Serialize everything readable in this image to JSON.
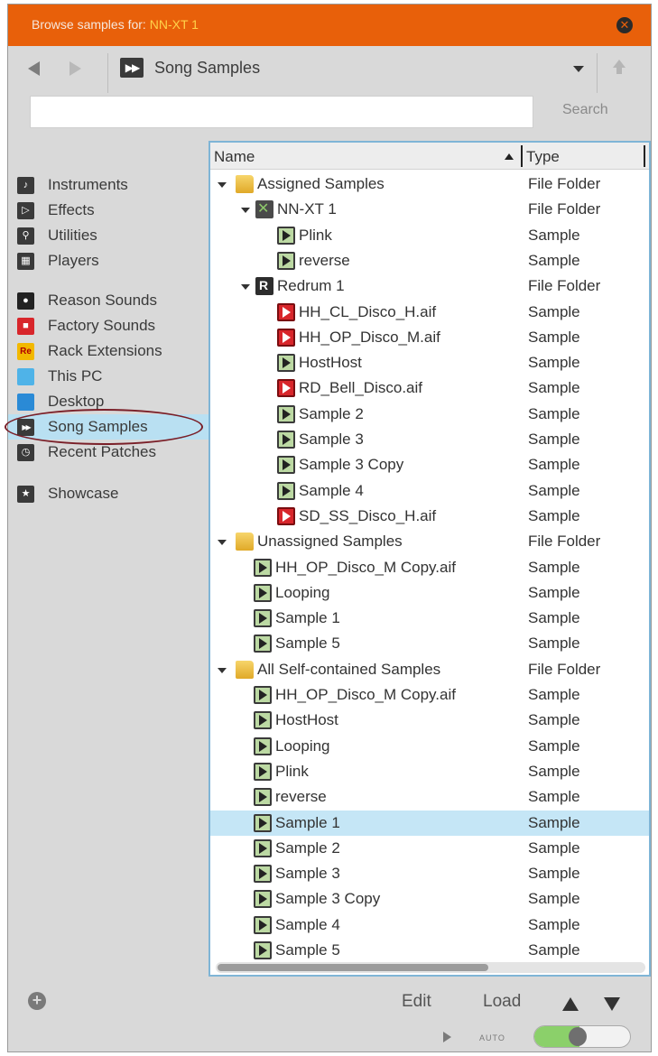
{
  "titlebar": {
    "prefix": "Browse samples for: ",
    "device": "NN-XT 1"
  },
  "toolbar": {
    "location": "Song Samples"
  },
  "search": {
    "value": "",
    "button_label": "Search"
  },
  "sidebar": {
    "items": [
      {
        "label": "Instruments",
        "icon": "instruments-icon",
        "color": "#3a3a3a",
        "glyph": "♪"
      },
      {
        "label": "Effects",
        "icon": "effects-icon",
        "color": "#3a3a3a",
        "glyph": "▷"
      },
      {
        "label": "Utilities",
        "icon": "utilities-icon",
        "color": "#3a3a3a",
        "glyph": "⚲"
      },
      {
        "label": "Players",
        "icon": "players-icon",
        "color": "#3a3a3a",
        "glyph": "▦"
      },
      {
        "label": "Reason Sounds",
        "icon": "reason-sounds-icon",
        "color": "#222222",
        "glyph": "●"
      },
      {
        "label": "Factory Sounds",
        "icon": "factory-sounds-icon",
        "color": "#d8262b",
        "glyph": "■"
      },
      {
        "label": "Rack Extensions",
        "icon": "rack-extensions-icon",
        "color": "#f2b800",
        "glyph": "Re"
      },
      {
        "label": "This PC",
        "icon": "this-pc-icon",
        "color": "#4fb3e8",
        "glyph": ""
      },
      {
        "label": "Desktop",
        "icon": "desktop-icon",
        "color": "#2a8ad6",
        "glyph": ""
      },
      {
        "label": "Song Samples",
        "icon": "song-samples-icon",
        "color": "#3a3a3a",
        "glyph": "▶▶"
      },
      {
        "label": "Recent Patches",
        "icon": "recent-patches-icon",
        "color": "#3a3a3a",
        "glyph": "◷"
      },
      {
        "label": "Showcase",
        "icon": "showcase-icon",
        "color": "#3a3a3a",
        "glyph": "★"
      }
    ],
    "selected": "Song Samples"
  },
  "filelist": {
    "columns": {
      "name": "Name",
      "type": "Type"
    },
    "rows": [
      {
        "name": "Assigned Samples",
        "type": "File Folder",
        "icon": "folder",
        "depth": 0,
        "expander": true
      },
      {
        "name": "NN-XT 1",
        "type": "File Folder",
        "icon": "nnxt",
        "depth": 1,
        "expander": true
      },
      {
        "name": "Plink",
        "type": "Sample",
        "icon": "sample",
        "depth": 2,
        "expander": false
      },
      {
        "name": "reverse",
        "type": "Sample",
        "icon": "sample",
        "depth": 2,
        "expander": false
      },
      {
        "name": "Redrum 1",
        "type": "File Folder",
        "icon": "redrum",
        "depth": 1,
        "expander": true
      },
      {
        "name": "HH_CL_Disco_H.aif",
        "type": "Sample",
        "icon": "aif",
        "depth": 2,
        "expander": false
      },
      {
        "name": "HH_OP_Disco_M.aif",
        "type": "Sample",
        "icon": "aif",
        "depth": 2,
        "expander": false
      },
      {
        "name": "HostHost",
        "type": "Sample",
        "icon": "sample",
        "depth": 2,
        "expander": false
      },
      {
        "name": "RD_Bell_Disco.aif",
        "type": "Sample",
        "icon": "aif",
        "depth": 2,
        "expander": false
      },
      {
        "name": "Sample 2",
        "type": "Sample",
        "icon": "sample",
        "depth": 2,
        "expander": false
      },
      {
        "name": "Sample 3",
        "type": "Sample",
        "icon": "sample",
        "depth": 2,
        "expander": false
      },
      {
        "name": "Sample 3 Copy",
        "type": "Sample",
        "icon": "sample",
        "depth": 2,
        "expander": false
      },
      {
        "name": "Sample 4",
        "type": "Sample",
        "icon": "sample",
        "depth": 2,
        "expander": false
      },
      {
        "name": "SD_SS_Disco_H.aif",
        "type": "Sample",
        "icon": "aif",
        "depth": 2,
        "expander": false
      },
      {
        "name": "Unassigned Samples",
        "type": "File Folder",
        "icon": "folder",
        "depth": 0,
        "expander": true
      },
      {
        "name": "HH_OP_Disco_M Copy.aif",
        "type": "Sample",
        "icon": "sample",
        "depth": 1,
        "expander": false
      },
      {
        "name": "Looping",
        "type": "Sample",
        "icon": "sample",
        "depth": 1,
        "expander": false
      },
      {
        "name": "Sample 1",
        "type": "Sample",
        "icon": "sample",
        "depth": 1,
        "expander": false
      },
      {
        "name": "Sample 5",
        "type": "Sample",
        "icon": "sample",
        "depth": 1,
        "expander": false
      },
      {
        "name": "All Self-contained Samples",
        "type": "File Folder",
        "icon": "folder",
        "depth": 0,
        "expander": true
      },
      {
        "name": "HH_OP_Disco_M Copy.aif",
        "type": "Sample",
        "icon": "sample",
        "depth": 1,
        "expander": false
      },
      {
        "name": "HostHost",
        "type": "Sample",
        "icon": "sample",
        "depth": 1,
        "expander": false
      },
      {
        "name": "Looping",
        "type": "Sample",
        "icon": "sample",
        "depth": 1,
        "expander": false
      },
      {
        "name": "Plink",
        "type": "Sample",
        "icon": "sample",
        "depth": 1,
        "expander": false
      },
      {
        "name": "reverse",
        "type": "Sample",
        "icon": "sample",
        "depth": 1,
        "expander": false
      },
      {
        "name": "Sample 1",
        "type": "Sample",
        "icon": "sample",
        "depth": 1,
        "expander": false,
        "selected": true
      },
      {
        "name": "Sample 2",
        "type": "Sample",
        "icon": "sample",
        "depth": 1,
        "expander": false
      },
      {
        "name": "Sample 3",
        "type": "Sample",
        "icon": "sample",
        "depth": 1,
        "expander": false
      },
      {
        "name": "Sample 3 Copy",
        "type": "Sample",
        "icon": "sample",
        "depth": 1,
        "expander": false
      },
      {
        "name": "Sample 4",
        "type": "Sample",
        "icon": "sample",
        "depth": 1,
        "expander": false
      },
      {
        "name": "Sample 5",
        "type": "Sample",
        "icon": "sample",
        "depth": 1,
        "expander": false
      }
    ]
  },
  "footer": {
    "edit_label": "Edit",
    "load_label": "Load",
    "auto_label": "AUTO",
    "autoplay_on": true
  },
  "colors": {
    "titlebar": "#e8600a",
    "selection": "#c5e6f6",
    "list_border": "#7fb5d6",
    "toggle_on": "#8bd06a"
  }
}
